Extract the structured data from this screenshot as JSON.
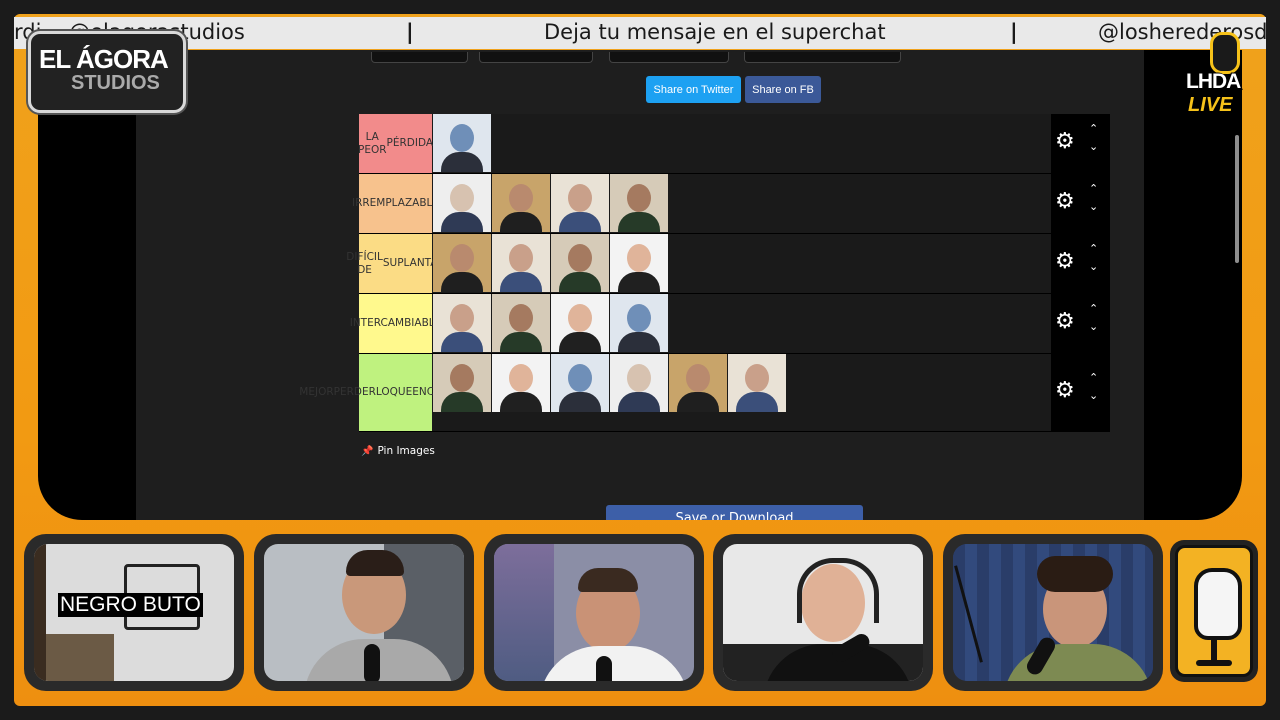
{
  "ticker": {
    "left_text": "rdi… @elagorastudios",
    "center_text": "Deja tu mensaje en el superchat",
    "right_text": "@losherederosdo"
  },
  "logos": {
    "agora_line1": "EL ÁGORA",
    "agora_line2": "STUDIOS",
    "lhda_line1": "LHDA",
    "lhda_line2": "LIVE"
  },
  "browser": {
    "share_twitter": "Share on Twitter",
    "share_fb": "Share on FB",
    "pin_images": "Pin Images",
    "save_download": "Save or Download"
  },
  "tiers": [
    {
      "label": "LA PEOR PÉRDIDA",
      "color": "#f28b8b",
      "count": 1
    },
    {
      "label": "IRREMPLAZABLE",
      "color": "#f7c28d",
      "count": 4
    },
    {
      "label": "DIFÍCIL DE SUPLANTAR",
      "color": "#fbdc85",
      "count": 4
    },
    {
      "label": "INTERCAMBIABLE",
      "color": "#fff98d",
      "count": 4
    },
    {
      "label": "MEJOR PERDERLO QUE ENCONTRARLO",
      "color": "#bff27f",
      "count": 6
    }
  ],
  "tier_label_lines": [
    [
      "LA PEOR",
      "PÉRDIDA"
    ],
    [
      "IRREMPLAZ",
      "ABLE"
    ],
    [
      "DIFÍCIL DE",
      "SUPLANTAR"
    ],
    [
      "INTERCAMB",
      "IABLE"
    ],
    [
      "MEJOR",
      "PERDERLO",
      "QUE",
      "ENCONTRA",
      "RLO"
    ]
  ],
  "webcams": {
    "cam1_name": "NEGRO BUTO"
  },
  "colors": {
    "frame_orange": "#f29a12",
    "twitter_blue": "#1da1f2",
    "fb_blue": "#3b5998"
  }
}
